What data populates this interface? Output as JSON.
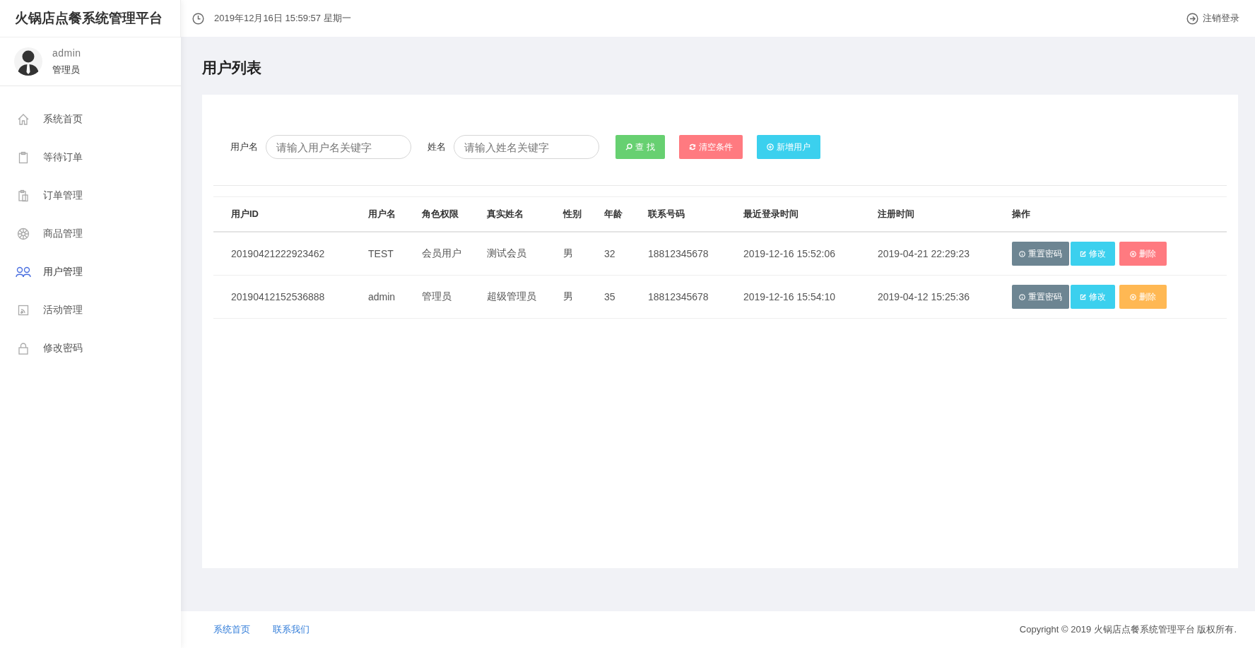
{
  "app_title": "火锅店点餐系统管理平台",
  "header": {
    "datetime": "2019年12月16日 15:59:57 星期一",
    "logout": "注销登录"
  },
  "user": {
    "name": "admin",
    "role": "管理员"
  },
  "sidebar": {
    "items": [
      {
        "label": "系统首页",
        "selected": false
      },
      {
        "label": "等待订单",
        "selected": false
      },
      {
        "label": "订单管理",
        "selected": false
      },
      {
        "label": "商品管理",
        "selected": false
      },
      {
        "label": "用户管理",
        "selected": true
      },
      {
        "label": "活动管理",
        "selected": false
      },
      {
        "label": "修改密码",
        "selected": false
      }
    ]
  },
  "page_title": "用户列表",
  "search": {
    "fields": [
      {
        "label": "用户名",
        "placeholder": "请输入用户名关键字"
      },
      {
        "label": "姓名",
        "placeholder": "请输入姓名关键字"
      }
    ],
    "buttons": [
      {
        "label": "查 找",
        "kind": "search"
      },
      {
        "label": "清空条件",
        "kind": "clear"
      },
      {
        "label": "新增用户",
        "kind": "add"
      }
    ]
  },
  "table": {
    "columns": [
      "用户ID",
      "用户名",
      "角色权限",
      "真实姓名",
      "性别",
      "年龄",
      "联系号码",
      "最近登录时间",
      "注册时间",
      "操作"
    ],
    "rows": [
      {
        "cells": [
          "20190421222923462",
          "TEST",
          "会员用户",
          "测试会员",
          "男",
          "32",
          "18812345678",
          "2019-12-16 15:52:06",
          "2019-04-21 22:29:23"
        ],
        "actions": [
          {
            "label": "重置密码",
            "kind": "reset",
            "disabled": false
          },
          {
            "label": "修改",
            "kind": "edit",
            "disabled": false
          },
          {
            "label": "删除",
            "kind": "delete",
            "disabled": false
          }
        ]
      },
      {
        "cells": [
          "20190412152536888",
          "admin",
          "管理员",
          "超级管理员",
          "男",
          "35",
          "18812345678",
          "2019-12-16 15:54:10",
          "2019-04-12 15:25:36"
        ],
        "actions": [
          {
            "label": "重置密码",
            "kind": "reset",
            "disabled": false
          },
          {
            "label": "修改",
            "kind": "edit",
            "disabled": false
          },
          {
            "label": "删除",
            "kind": "delete",
            "disabled": true
          }
        ]
      }
    ]
  },
  "footer": {
    "links": [
      "系统首页",
      "联系我们"
    ],
    "copyright": "Copyright © 2019 火锅店点餐系统管理平台 版权所有."
  }
}
